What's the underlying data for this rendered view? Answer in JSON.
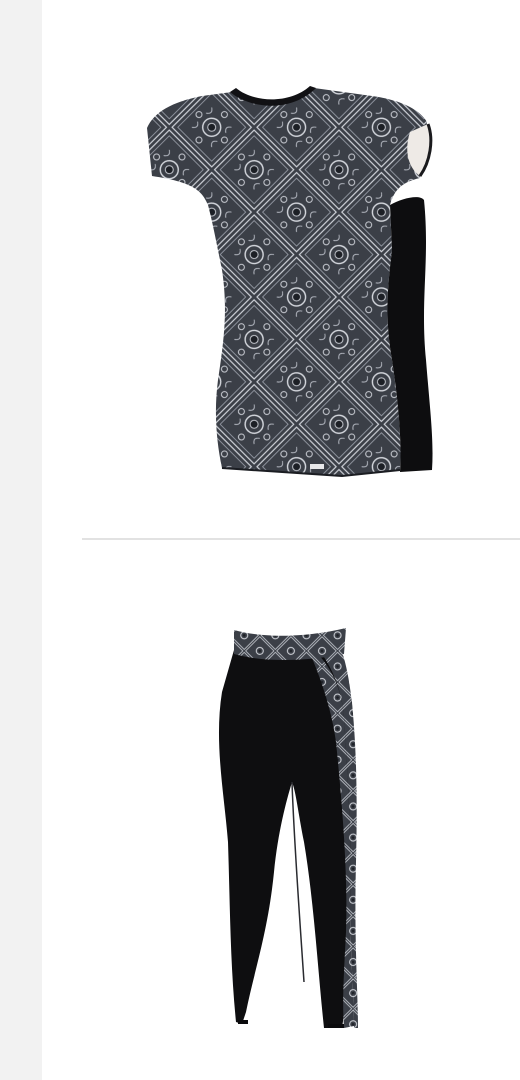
{
  "products": [
    {
      "name": "",
      "image": {
        "icon": "short-sleeve-top-icon",
        "colors": {
          "pattern_base": "#3b3f47",
          "pattern_ink": "#c9ccd3",
          "panel": "#0d0d0f",
          "neckband": "#111114"
        }
      }
    },
    {
      "name": "",
      "image": {
        "icon": "leggings-icon",
        "colors": {
          "pattern_base": "#3b3f47",
          "pattern_ink": "#c9ccd3",
          "body": "#0e0e10"
        }
      }
    }
  ]
}
